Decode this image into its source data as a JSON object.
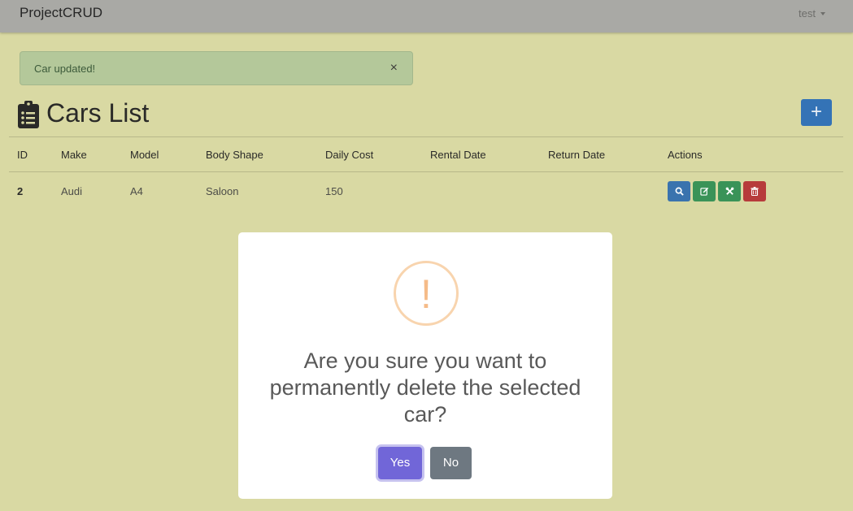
{
  "navbar": {
    "brand": "ProjectCRUD",
    "user": "test"
  },
  "alert": {
    "message": "Car updated!",
    "close_symbol": "×"
  },
  "page": {
    "title": "Cars List",
    "add_symbol": "+"
  },
  "table": {
    "headers": [
      "ID",
      "Make",
      "Model",
      "Body Shape",
      "Daily Cost",
      "Rental Date",
      "Return Date",
      "Actions"
    ],
    "rows": [
      {
        "id": "2",
        "make": "Audi",
        "model": "A4",
        "body_shape": "Saloon",
        "daily_cost": "150",
        "rental_date": "",
        "return_date": ""
      }
    ],
    "actions": [
      "search-icon",
      "edit-icon",
      "tools-icon",
      "trash-icon"
    ]
  },
  "dialog": {
    "icon": "!",
    "title": "Are you sure you want to permanently delete the selected car?",
    "confirm_label": "Yes",
    "cancel_label": "No"
  },
  "colors": {
    "backdrop": "#d9d9a3",
    "primary": "#3473b6",
    "success": "#3a9358",
    "danger": "#b73b3b",
    "confirm": "#7166d8",
    "cancel": "#6e7881",
    "warning": "#f5bb88"
  }
}
